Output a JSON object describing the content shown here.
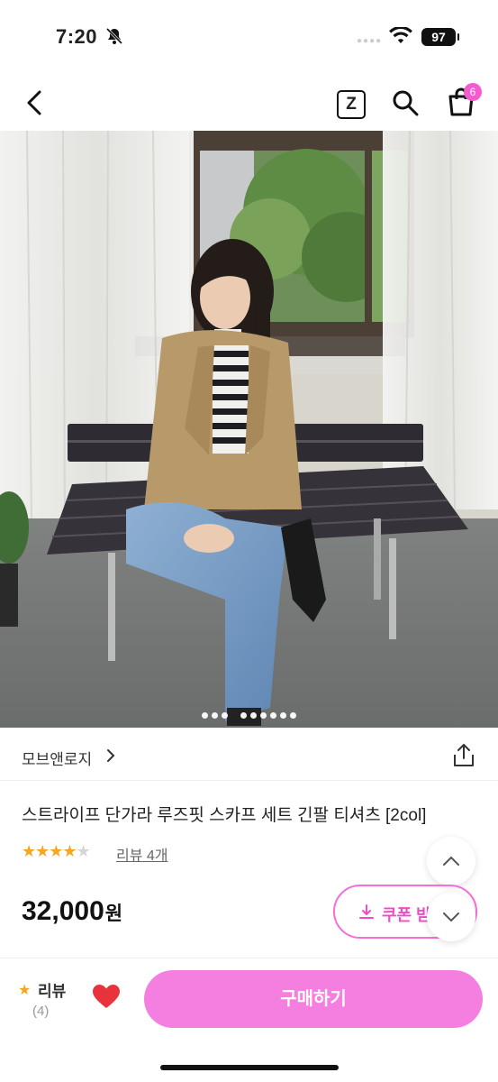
{
  "status_bar": {
    "time": "7:20",
    "battery": "97"
  },
  "nav": {
    "z_label": "Z",
    "cart_count": "6"
  },
  "gallery": {
    "total_images": 9,
    "current_image": 1
  },
  "seller": {
    "name": "모브앤로지"
  },
  "product": {
    "title": "스트라이프 단가라 루즈핏 스카프 세트 긴팔 티셔츠 [2col]",
    "rating_stars": 4,
    "review_link": "리뷰 4개",
    "price": "32,000",
    "currency": "원",
    "coupon_label": "쿠폰 받"
  },
  "bottom_bar": {
    "review_label": "리뷰",
    "review_count": "(4)",
    "buy_label": "구매하기"
  },
  "colors": {
    "accent": "#f57fe0",
    "coupon_border": "#f56fd6",
    "star": "#f6a623",
    "heart": "#e8323c"
  }
}
